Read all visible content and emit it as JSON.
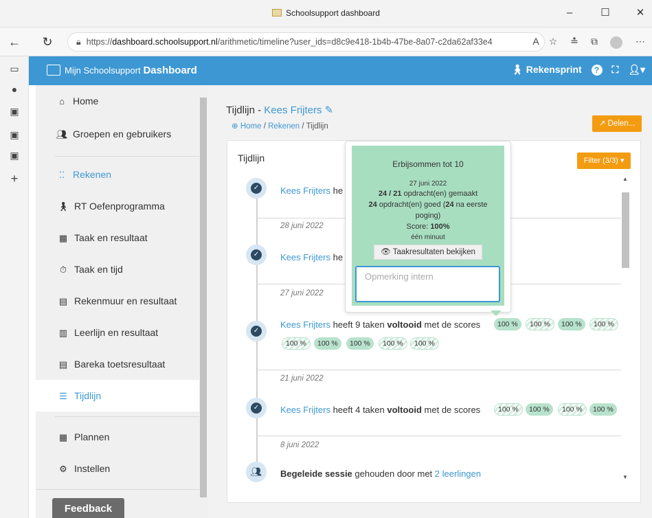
{
  "browser": {
    "tab_title": "Schoolsupport dashboard",
    "url_prefix": "https://",
    "url_domain": "dashboard.schoolsupport.nl",
    "url_path": "/arithmetic/timeline?user_ids=d8c9e418-1b4b-47be-8a07-c2da62af33e4"
  },
  "header": {
    "brand_sub": "Mijn Schoolsupport",
    "brand_main": "Dashboard",
    "app_switch": "Rekensprint"
  },
  "nav": {
    "items": [
      {
        "label": "Home",
        "icon": "home-icon"
      },
      {
        "label": "Groepen en gebruikers",
        "icon": "users-icon"
      },
      {
        "label": "Rekenen",
        "icon": "grid-icon"
      },
      {
        "label": "RT Oefenprogramma",
        "icon": "figure-icon"
      },
      {
        "label": "Taak en resultaat",
        "icon": "chart-icon"
      },
      {
        "label": "Taak en tijd",
        "icon": "stopwatch-icon"
      },
      {
        "label": "Rekenmuur en resultaat",
        "icon": "wall-icon"
      },
      {
        "label": "Leerlijn en resultaat",
        "icon": "calendar-check-icon"
      },
      {
        "label": "Bareka toetsresultaat",
        "icon": "table-icon"
      },
      {
        "label": "Tijdlijn",
        "icon": "list-icon"
      },
      {
        "label": "Plannen",
        "icon": "calendar-icon"
      },
      {
        "label": "Instellen",
        "icon": "gear-icon"
      }
    ],
    "feedback": "Feedback"
  },
  "page": {
    "title_prefix": "Tijdlijn - ",
    "title_name": "Kees Frijters",
    "breadcrumb": [
      "Home",
      "Rekenen",
      "Tijdlijn"
    ],
    "share_button": "Delen...",
    "card_title": "Tijdlijn",
    "filter_button": "Filter (3/3)"
  },
  "timeline": {
    "student": "Kees Frijters",
    "entry1_suffix": "he",
    "entry2_suffix": "he",
    "date1": "28 juni 2022",
    "date2": "27 juni 2022",
    "entry3_middle": " heeft 9 taken ",
    "entry3_bold": "voltooid",
    "entry3_end": " met de scores",
    "date3": "21 juni 2022",
    "entry4_middle": " heeft 4 taken ",
    "entry4_bold": "voltooid",
    "entry4_end": " met de scores",
    "date4": "8 juni 2022",
    "entry5_bold": "Begeleide sessie",
    "entry5_middle": " gehouden door met ",
    "entry5_link": "2 leerlingen",
    "score_label": "100 %"
  },
  "popover": {
    "title": "Erbijsommen tot 10",
    "date": "27 juni 2022",
    "made_num": "24 / 21",
    "made_text": " opdracht(en) gemaakt",
    "good_num": "24",
    "good_text1": " opdracht(en) goed (",
    "good_num2": "24",
    "good_text2": " na eerste",
    "good_text3": "poging)",
    "score_label": "Score: ",
    "score_value": "100%",
    "duration": "één minuut",
    "results_button": "Taakresultaten bekijken",
    "remark_placeholder": "Opmerking intern"
  }
}
